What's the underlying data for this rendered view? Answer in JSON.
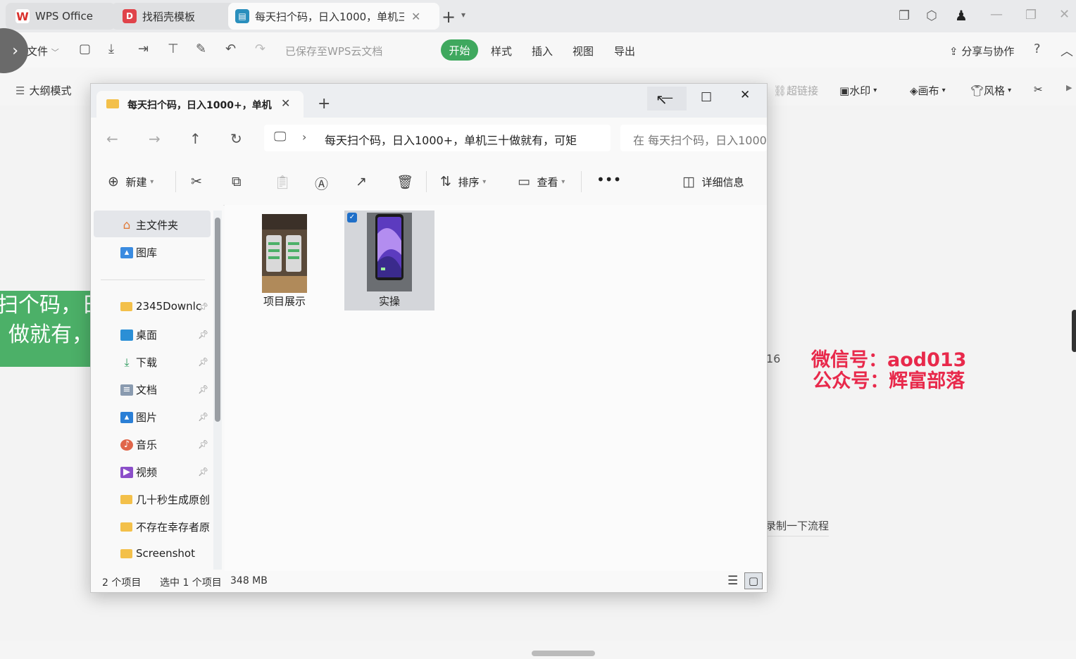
{
  "wps": {
    "tabs": [
      {
        "label": "WPS Office"
      },
      {
        "label": "找稻壳模板"
      },
      {
        "label": "每天扫个码，日入1000，单机三"
      }
    ],
    "toolbar": {
      "file_label": "文件",
      "saved_status": "已保存至WPS云文档",
      "menus": [
        "开始",
        "样式",
        "插入",
        "视图",
        "导出"
      ],
      "share_label": "分享与协作"
    },
    "ribbon": {
      "outline_mode": "大纲模式",
      "hyperlink": "超链接",
      "watermark": "水印",
      "canvas": "画布",
      "style": "风格"
    }
  },
  "document": {
    "green_text_line1": "扫个码，日",
    "green_text_line2": "做就有，",
    "number_fragment": "16",
    "flow_text": "录制一下流程",
    "overlay_line1": "微信号：aod013",
    "overlay_line2": "公众号：辉富部落"
  },
  "explorer": {
    "tab_title": "每天扫个码，日入1000+，单机",
    "address": "每天扫个码，日入1000+，单机三十做就有，可矩",
    "search_placeholder": "在 每天扫个码，日入1000",
    "commands": {
      "new": "新建",
      "sort": "排序",
      "view": "查看",
      "details": "详细信息"
    },
    "sidebar": {
      "home": "主文件夹",
      "gallery": "图库",
      "items": [
        {
          "label": "2345Downlc",
          "pinned": true
        },
        {
          "label": "桌面",
          "pinned": true
        },
        {
          "label": "下载",
          "pinned": true
        },
        {
          "label": "文档",
          "pinned": true
        },
        {
          "label": "图片",
          "pinned": true
        },
        {
          "label": "音乐",
          "pinned": true
        },
        {
          "label": "视频",
          "pinned": true
        },
        {
          "label": "几十秒生成原创",
          "pinned": false
        },
        {
          "label": "不存在幸存者原",
          "pinned": false
        },
        {
          "label": "Screenshot",
          "pinned": false
        }
      ]
    },
    "files": [
      {
        "name": "项目展示",
        "selected": false
      },
      {
        "name": "实操",
        "selected": true
      }
    ],
    "status": {
      "count": "2 个项目",
      "selection": "选中 1 个项目",
      "size": "348 MB"
    }
  },
  "colors": {
    "wps_green": "#3fa85e",
    "doc_green": "#4cb068",
    "watermark_red": "#e8294b",
    "folder_yellow": "#f3c04a"
  }
}
